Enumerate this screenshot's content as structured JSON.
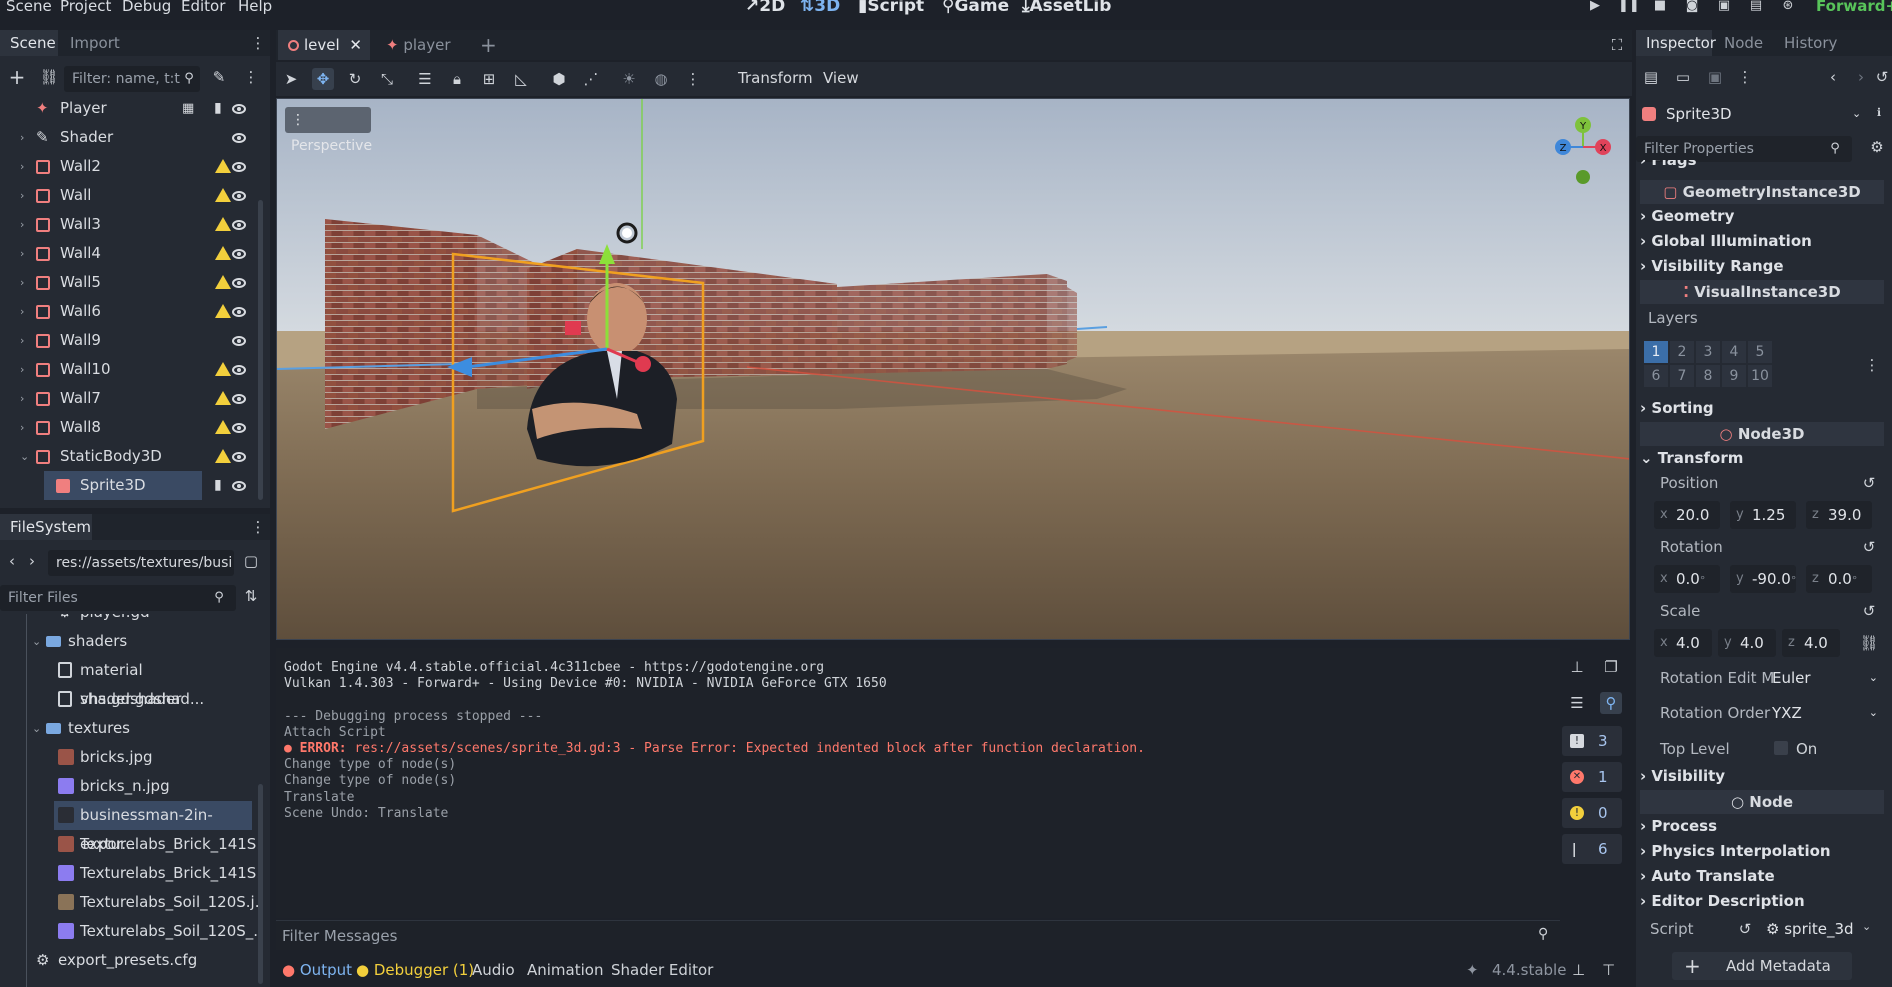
{
  "menu": [
    "Scene",
    "Project",
    "Debug",
    "Editor",
    "Help"
  ],
  "workspaces": {
    "w2d": "2D",
    "w3d": "3D",
    "script": "Script",
    "game": "Game",
    "assetlib": "AssetLib"
  },
  "renderer": "Forward+",
  "scene_dock": {
    "tabs": [
      "Scene",
      "Import"
    ],
    "filter_placeholder": "Filter: name, t:t",
    "tree": [
      {
        "name": "Player",
        "indent": 1,
        "arrow": "none",
        "warn": false,
        "icon": "player",
        "extra": "script"
      },
      {
        "name": "Shader",
        "indent": 1,
        "arrow": "right",
        "warn": false,
        "icon": "shader"
      },
      {
        "name": "Wall2",
        "indent": 1,
        "arrow": "right",
        "warn": true,
        "icon": "node"
      },
      {
        "name": "Wall",
        "indent": 1,
        "arrow": "right",
        "warn": true,
        "icon": "node"
      },
      {
        "name": "Wall3",
        "indent": 1,
        "arrow": "right",
        "warn": true,
        "icon": "node"
      },
      {
        "name": "Wall4",
        "indent": 1,
        "arrow": "right",
        "warn": true,
        "icon": "node"
      },
      {
        "name": "Wall5",
        "indent": 1,
        "arrow": "right",
        "warn": true,
        "icon": "node"
      },
      {
        "name": "Wall6",
        "indent": 1,
        "arrow": "right",
        "warn": true,
        "icon": "node"
      },
      {
        "name": "Wall9",
        "indent": 1,
        "arrow": "right",
        "warn": false,
        "icon": "node"
      },
      {
        "name": "Wall10",
        "indent": 1,
        "arrow": "right",
        "warn": true,
        "icon": "node"
      },
      {
        "name": "Wall7",
        "indent": 1,
        "arrow": "right",
        "warn": true,
        "icon": "node"
      },
      {
        "name": "Wall8",
        "indent": 1,
        "arrow": "right",
        "warn": true,
        "icon": "node"
      },
      {
        "name": "StaticBody3D",
        "indent": 1,
        "arrow": "down",
        "warn": true,
        "icon": "node"
      },
      {
        "name": "Sprite3D",
        "indent": 2,
        "arrow": "none",
        "warn": false,
        "icon": "sprite",
        "selected": true,
        "extra": "script"
      }
    ]
  },
  "filesystem": {
    "tab": "FileSystem",
    "path": "res://assets/textures/busi",
    "filter_placeholder": "Filter Files",
    "items": [
      {
        "name": "player.gd",
        "kind": "gear",
        "indent": 3
      },
      {
        "name": "shaders",
        "kind": "folder",
        "indent": 2,
        "arrow": "down"
      },
      {
        "name": "material shader.gdshad...",
        "kind": "file",
        "indent": 3
      },
      {
        "name": "vhs.gdshader",
        "kind": "file",
        "indent": 3
      },
      {
        "name": "textures",
        "kind": "folder",
        "indent": 2,
        "arrow": "down"
      },
      {
        "name": "bricks.jpg",
        "kind": "brick",
        "indent": 3
      },
      {
        "name": "bricks_n.jpg",
        "kind": "normal",
        "indent": 3
      },
      {
        "name": "businessman-2in-expor...",
        "kind": "person",
        "indent": 3,
        "selected": true
      },
      {
        "name": "Texturelabs_Brick_141S...",
        "kind": "brick",
        "indent": 3
      },
      {
        "name": "Texturelabs_Brick_141S...",
        "kind": "normal",
        "indent": 3
      },
      {
        "name": "Texturelabs_Soil_120S.j...",
        "kind": "soil",
        "indent": 3
      },
      {
        "name": "Texturelabs_Soil_120S_...",
        "kind": "normal",
        "indent": 3
      },
      {
        "name": "export_presets.cfg",
        "kind": "gear",
        "indent": 1
      }
    ]
  },
  "editor_tabs": [
    "level",
    "player"
  ],
  "viewport_toolbar": {
    "transform": "Transform",
    "view": "View"
  },
  "viewport": {
    "perspective_label": "Perspective",
    "gizmo": {
      "x": "X",
      "y": "Y",
      "z": "Z"
    }
  },
  "output": {
    "lines": [
      {
        "text": "Godot Engine v4.4.stable.official.4c311cbee - https://godotengine.org",
        "type": "normal"
      },
      {
        "text": "Vulkan 1.4.303 - Forward+ - Using Device #0: NVIDIA - NVIDIA GeForce GTX 1650",
        "type": "normal"
      },
      {
        "text": "",
        "type": "normal"
      },
      {
        "text": "--- Debugging process stopped ---",
        "type": "dim"
      },
      {
        "text": "Attach Script",
        "type": "dim"
      },
      {
        "text": "ERROR: res://assets/scenes/sprite_3d.gd:3 - Parse Error: Expected indented block after function declaration.",
        "type": "error"
      },
      {
        "text": "Change type of node(s)",
        "type": "dim"
      },
      {
        "text": "Change type of node(s)",
        "type": "dim"
      },
      {
        "text": "Translate",
        "type": "dim"
      },
      {
        "text": "Scene Undo: Translate",
        "type": "dim"
      }
    ],
    "error_prefix": "ERROR:",
    "error_body": " res://assets/scenes/sprite_3d.gd:3 - Parse Error: Expected indented block after function declaration.",
    "filter_placeholder": "Filter Messages",
    "counts": {
      "messages": "3",
      "errors": "1",
      "warnings": "0",
      "editor": "6"
    }
  },
  "bottom_tabs": {
    "output": "Output",
    "debugger": "Debugger (1)",
    "audio": "Audio",
    "animation": "Animation",
    "shader_editor": "Shader Editor",
    "version": "4.4.stable"
  },
  "inspector": {
    "tabs": [
      "Inspector",
      "Node",
      "History"
    ],
    "object": "Sprite3D",
    "filter_placeholder": "Filter Properties",
    "flags": "Flags",
    "geometry_instance": "GeometryInstance3D",
    "geometry": "Geometry",
    "global_illumination": "Global Illumination",
    "visibility_range": "Visibility Range",
    "visual_instance": "VisualInstance3D",
    "layers_label": "Layers",
    "layers": [
      "1",
      "2",
      "3",
      "4",
      "5",
      "6",
      "7",
      "8",
      "9",
      "10"
    ],
    "sorting": "Sorting",
    "node3d": "Node3D",
    "transform": "Transform",
    "position_label": "Position",
    "position": {
      "x": "20.0",
      "y": "1.25",
      "z": "39.0"
    },
    "rotation_label": "Rotation",
    "rotation": {
      "x": "0.0",
      "y": "-90.0",
      "z": "0.0"
    },
    "scale_label": "Scale",
    "scale": {
      "x": "4.0",
      "y": "4.0",
      "z": "4.0"
    },
    "rotation_edit_label": "Rotation Edit M",
    "rotation_edit_value": "Euler",
    "rotation_order_label": "Rotation Order",
    "rotation_order_value": "YXZ",
    "top_level_label": "Top Level",
    "top_level_value": "On",
    "visibility": "Visibility",
    "node": "Node",
    "process": "Process",
    "physics_interpolation": "Physics Interpolation",
    "auto_translate": "Auto Translate",
    "editor_description": "Editor Description",
    "script_label": "Script",
    "script_value": "sprite_3d",
    "add_metadata": "Add Metadata"
  },
  "colors": {
    "accent": "#7eb4f0",
    "error": "#ff786b",
    "warning": "#f2cf3c",
    "selection": "#3a4a63",
    "node_red": "#f07f7f"
  }
}
